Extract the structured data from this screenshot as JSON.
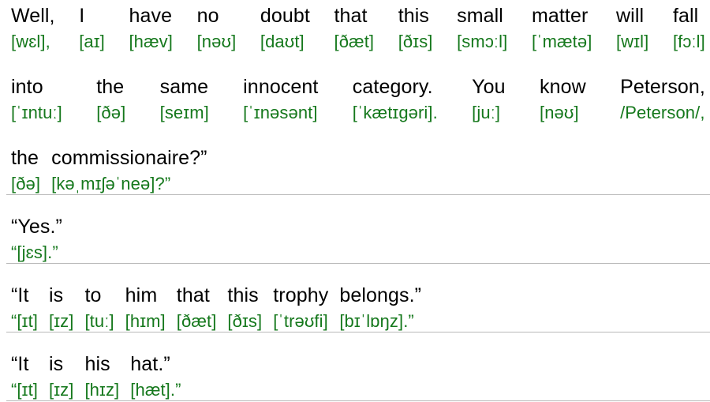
{
  "document": {
    "title": "Interlinear English text with IPA transcription",
    "text_color": "#000000",
    "ipa_color": "#15781c",
    "rule_color": "#b9b9b9",
    "background": "#ffffff"
  },
  "paragraphs": [
    {
      "id": "paragraph-1",
      "underlined_last_line": true,
      "lines": [
        {
          "id": "line-1",
          "align": "justify",
          "underlined": false,
          "words": [
            {
              "en": "Well,",
              "ipa": "[wɛl],"
            },
            {
              "en": "I",
              "ipa": "[aɪ]"
            },
            {
              "en": "have",
              "ipa": "[hæv]"
            },
            {
              "en": "no",
              "ipa": "[nəʊ]"
            },
            {
              "en": "doubt",
              "ipa": "[daʊt]"
            },
            {
              "en": "that",
              "ipa": "[ðæt]"
            },
            {
              "en": "this",
              "ipa": "[ðɪs]"
            },
            {
              "en": "small",
              "ipa": "[smɔːl]"
            },
            {
              "en": "matter",
              "ipa": "[ˈmætə]"
            },
            {
              "en": "will",
              "ipa": "[wɪl]"
            },
            {
              "en": "fall",
              "ipa": "[fɔːl]"
            }
          ]
        },
        {
          "id": "line-2",
          "align": "justify",
          "underlined": false,
          "words": [
            {
              "en": "into",
              "ipa": "[ˈɪntuː]"
            },
            {
              "en": "the",
              "ipa": "[ðə]"
            },
            {
              "en": "same",
              "ipa": "[seɪm]"
            },
            {
              "en": "innocent",
              "ipa": "[ˈɪnəsənt]"
            },
            {
              "en": "category.",
              "ipa": "[ˈkætɪgəri]."
            },
            {
              "en": "You",
              "ipa": "[juː]"
            },
            {
              "en": "know",
              "ipa": "[nəʊ]"
            },
            {
              "en": "Peterson,",
              "ipa": "/Peterson/,"
            }
          ]
        },
        {
          "id": "line-3",
          "align": "left",
          "underlined": true,
          "words": [
            {
              "en": "the",
              "ipa": "[ðə]"
            },
            {
              "en": "commissionaire?”",
              "ipa": "[kəˌmɪʃəˈneə]?”"
            }
          ]
        }
      ]
    },
    {
      "id": "paragraph-2",
      "underlined_last_line": true,
      "lines": [
        {
          "id": "line-4",
          "align": "left",
          "underlined": true,
          "words": [
            {
              "en": "“Yes.”",
              "ipa": "“[jɛs].”"
            }
          ]
        }
      ]
    },
    {
      "id": "paragraph-3",
      "underlined_last_line": true,
      "lines": [
        {
          "id": "line-5",
          "align": "left",
          "underlined": true,
          "words": [
            {
              "en": "“It",
              "ipa": "“[ɪt]"
            },
            {
              "en": "is",
              "ipa": "[ɪz]"
            },
            {
              "en": "to",
              "ipa": "[tuː]"
            },
            {
              "en": "him",
              "ipa": "[hɪm]"
            },
            {
              "en": "that",
              "ipa": "[ðæt]"
            },
            {
              "en": "this",
              "ipa": "[ðɪs]"
            },
            {
              "en": "trophy",
              "ipa": "[ˈtrəʊfi]"
            },
            {
              "en": "belongs.”",
              "ipa": "[bɪˈlɒŋz].”"
            }
          ]
        }
      ]
    },
    {
      "id": "paragraph-4",
      "underlined_last_line": true,
      "lines": [
        {
          "id": "line-6",
          "align": "left",
          "underlined": true,
          "words": [
            {
              "en": "“It",
              "ipa": "“[ɪt]"
            },
            {
              "en": "is",
              "ipa": "[ɪz]"
            },
            {
              "en": "his",
              "ipa": "[hɪz]"
            },
            {
              "en": "hat.”",
              "ipa": "[hæt].”"
            }
          ]
        }
      ]
    }
  ]
}
